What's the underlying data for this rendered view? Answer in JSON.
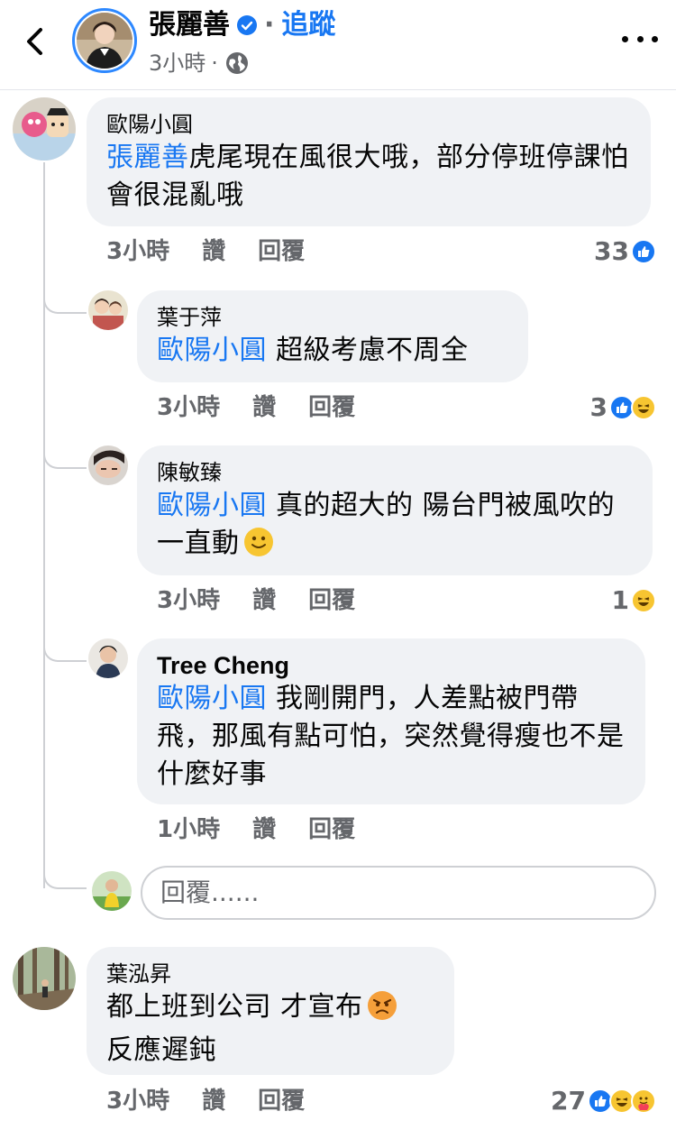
{
  "header": {
    "page_name": "張麗善",
    "separator": "·",
    "follow_label": "追蹤",
    "post_time": "3小時",
    "post_time_dot": "·"
  },
  "comments": [
    {
      "author": "歐陽小圓",
      "mention": "張麗善",
      "text": "虎尾現在風很大哦，部分停班停課怕會很混亂哦",
      "time": "3小時",
      "like_label": "讚",
      "reply_label": "回覆",
      "reaction_count": "33",
      "reactions": [
        "like-icon"
      ]
    },
    {
      "author": "葉于萍",
      "mention": "歐陽小圓",
      "text": " 超級考慮不周全",
      "time": "3小時",
      "like_label": "讚",
      "reply_label": "回覆",
      "reaction_count": "3",
      "reactions": [
        "like-icon",
        "haha-icon"
      ]
    },
    {
      "author": "陳敏臻",
      "mention": "歐陽小圓",
      "text": " 真的超大的 陽台門被風吹的一直動",
      "emoji": "slight-smile-emoji",
      "time": "3小時",
      "like_label": "讚",
      "reply_label": "回覆",
      "reaction_count": "1",
      "reactions": [
        "haha-icon"
      ]
    },
    {
      "author": "Tree Cheng",
      "mention": "歐陽小圓",
      "text": " 我剛開門，人差點被門帶飛，那風有點可怕，突然覺得瘦也不是什麼好事",
      "time": "1小時",
      "like_label": "讚",
      "reply_label": "回覆"
    },
    {
      "author": "葉泓昇",
      "text": "都上班到公司 才宣布",
      "text2": "反應遲鈍",
      "emoji": "angry-emoji",
      "time": "3小時",
      "like_label": "讚",
      "reply_label": "回覆",
      "reaction_count": "27",
      "reactions": [
        "like-icon",
        "haha-icon",
        "care-icon"
      ]
    }
  ],
  "reply_box": {
    "placeholder": "回覆......"
  },
  "colors": {
    "accent": "#1877f2",
    "bubble": "#f0f2f5",
    "meta": "#65676b"
  }
}
